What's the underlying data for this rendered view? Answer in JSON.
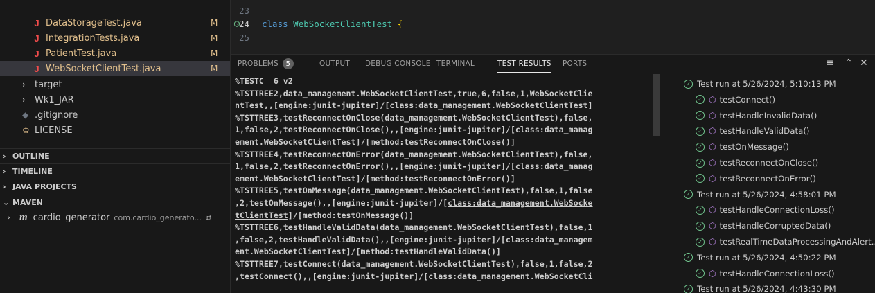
{
  "explorer": {
    "files": [
      {
        "label": "DataStorageTest.java",
        "status": "M"
      },
      {
        "label": "IntegrationTests.java",
        "status": "M"
      },
      {
        "label": "PatientTest.java",
        "status": "M"
      },
      {
        "label": "WebSocketClientTest.java",
        "status": "M"
      }
    ],
    "folders": [
      {
        "label": "target"
      },
      {
        "label": "Wk1_JAR"
      }
    ],
    "gitignore": ".gitignore",
    "license": "LICENSE"
  },
  "sections": {
    "outline": "OUTLINE",
    "timeline": "TIMELINE",
    "java_projects": "JAVA PROJECTS",
    "maven": "MAVEN",
    "maven_project": {
      "name": "cardio_generator",
      "group": "com.cardio_generato..."
    }
  },
  "editor": {
    "lines": [
      {
        "num": "23"
      },
      {
        "num": "24",
        "keyword": "class",
        "class_name": "WebSocketClientTest",
        "brace": "{"
      },
      {
        "num": "25"
      }
    ]
  },
  "panel": {
    "tabs": {
      "problems": "PROBLEMS",
      "problems_count": "5",
      "output": "OUTPUT",
      "debug_console": "DEBUG CONSOLE",
      "terminal": "TERMINAL",
      "test_results": "TEST RESULTS",
      "ports": "PORTS"
    },
    "output_lines": [
      "%TESTC  6 v2",
      "%TSTTREE2,data_management.WebSocketClientTest,true,6,false,1,WebSocketClie",
      "ntTest,,[engine:junit-jupiter]/[class:data_management.WebSocketClientTest]",
      "%TSTTREE3,testReconnectOnClose(data_management.WebSocketClientTest),false,",
      "1,false,2,testReconnectOnClose(),,[engine:junit-jupiter]/[class:data_manag",
      "ement.WebSocketClientTest]/[method:testReconnectOnClose()]",
      "%TSTTREE4,testReconnectOnError(data_management.WebSocketClientTest),false,",
      "1,false,2,testReconnectOnError(),,[engine:junit-jupiter]/[class:data_manag",
      "ement.WebSocketClientTest]/[method:testReconnectOnError()]",
      "%TSTTREE5,testOnMessage(data_management.WebSocketClientTest),false,1,false",
      ",2,testOnMessage(),,[engine:junit-jupiter]/[",
      "tClientTest",
      "%TSTTREE6,testHandleValidData(data_management.WebSocketClientTest),false,1",
      ",false,2,testHandleValidData(),,[engine:junit-jupiter]/[class:data_managem",
      "ent.WebSocketClientTest]/[method:testHandleValidData()]",
      "%TSTTREE7,testConnect(data_management.WebSocketClientTest),false,1,false,2",
      ",testConnect(),,[engine:junit-jupiter]/[class:data_management.WebSocketCli"
    ],
    "output_link_1": "class:data_management.WebSocke",
    "output_link_1_tail": "tClientTest",
    "output_link_1_after": "]/[method:testOnMessage()]",
    "test_runs": [
      {
        "label": "Test run at 5/26/2024, 5:10:13 PM",
        "tests": [
          "testConnect()",
          "testHandleInvalidData()",
          "testHandleValidData()",
          "testOnMessage()",
          "testReconnectOnClose()",
          "testReconnectOnError()"
        ]
      },
      {
        "label": "Test run at 5/26/2024, 4:58:01 PM",
        "tests": [
          "testHandleConnectionLoss()",
          "testHandleCorruptedData()",
          "testRealTimeDataProcessingAndAlert..."
        ]
      },
      {
        "label": "Test run at 5/26/2024, 4:50:22 PM",
        "tests": [
          "testHandleConnectionLoss()"
        ]
      },
      {
        "label": "Test run at 5/26/2024, 4:43:30 PM",
        "tests": []
      }
    ]
  },
  "colors": {
    "accent_pass": "#73c991",
    "modified": "#e2c08d",
    "java_icon": "#f14c4c"
  }
}
